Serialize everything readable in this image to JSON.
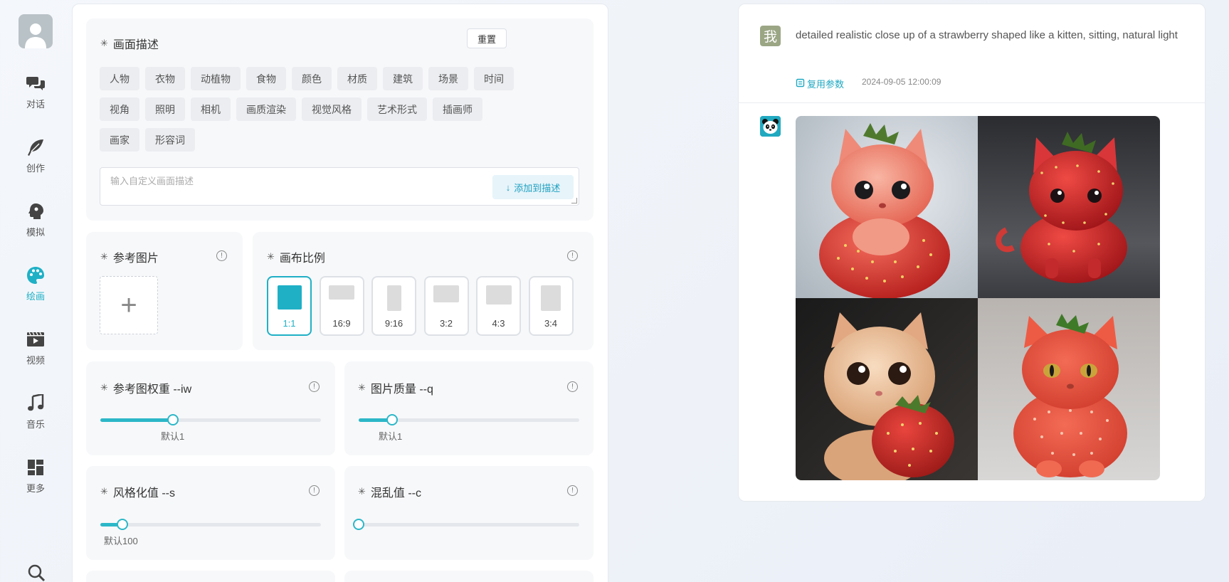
{
  "nav": {
    "items": [
      {
        "label": "对话",
        "icon": "chat-bubbles-icon"
      },
      {
        "label": "创作",
        "icon": "feather-icon"
      },
      {
        "label": "模拟",
        "icon": "head-profile-icon"
      },
      {
        "label": "绘画",
        "icon": "palette-icon",
        "active": true
      },
      {
        "label": "视频",
        "icon": "video-play-icon"
      },
      {
        "label": "音乐",
        "icon": "music-note-icon"
      },
      {
        "label": "更多",
        "icon": "dashboard-grid-icon"
      }
    ],
    "search_icon": "search-icon",
    "active_color": "#1fb0c6"
  },
  "description": {
    "title": "画面描述",
    "reset_label": "重置",
    "tags": [
      "人物",
      "衣物",
      "动植物",
      "食物",
      "颜色",
      "材质",
      "建筑",
      "场景",
      "时间",
      "视角",
      "照明",
      "相机",
      "画质渲染",
      "视觉风格",
      "艺术形式",
      "插画师",
      "画家",
      "形容词"
    ],
    "input_placeholder": "输入自定义画面描述",
    "input_value": "",
    "add_label": "添加到描述"
  },
  "reference": {
    "title": "参考图片",
    "upload_symbol": "+"
  },
  "ratio": {
    "title": "画布比例",
    "options": [
      "1:1",
      "16:9",
      "9:16",
      "3:2",
      "4:3",
      "3:4"
    ],
    "selected": "1:1"
  },
  "sliders": {
    "iw": {
      "title": "参考图权重 --iw",
      "default_label": "默认1",
      "value_fraction": 0.33
    },
    "q": {
      "title": "图片质量 --q",
      "default_label": "默认1",
      "value_fraction": 0.15
    },
    "s": {
      "title": "风格化值 --s",
      "default_label": "默认100",
      "value_fraction": 0.1
    },
    "c": {
      "title": "混乱值 --c",
      "default_label": "",
      "value_fraction": 0.0
    }
  },
  "chat": {
    "user_avatar_text": "我",
    "prompt": "detailed realistic close up of a strawberry shaped like a kitten, sitting, natural light",
    "reuse_label": "复用参数",
    "timestamp": "2024-09-05 12:00:09",
    "bot_avatar_icon": "panda-icon",
    "images": [
      "strawberry-kitten-1",
      "strawberry-kitten-2",
      "strawberry-kitten-3",
      "strawberry-kitten-4"
    ]
  }
}
